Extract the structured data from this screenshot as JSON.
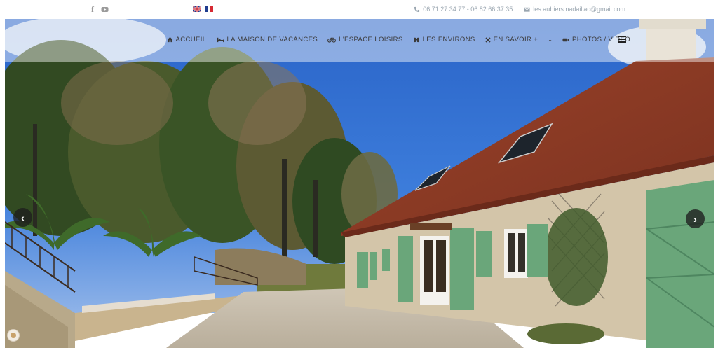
{
  "topbar": {
    "social": [
      {
        "icon": "facebook-icon",
        "glyph": "f"
      },
      {
        "icon": "youtube-icon"
      }
    ],
    "languages": [
      {
        "icon": "uk-flag-icon",
        "code": "en"
      },
      {
        "icon": "fr-flag-icon",
        "code": "fr"
      }
    ],
    "phone": "06 71 27 34 77 - 06 82 66 37 35",
    "email": "les.aubiers.nadaillac@gmail.com"
  },
  "nav": {
    "items": [
      {
        "label": "ACCUEIL",
        "icon": "home-icon"
      },
      {
        "label": "LA MAISON DE VACANCES",
        "icon": "bed-icon"
      },
      {
        "label": "L'ESPACE LOISIRS",
        "icon": "bicycle-icon"
      },
      {
        "label": "LES ENVIRONS",
        "icon": "binoculars-icon"
      },
      {
        "label": "EN SAVOIR +",
        "icon": "close-icon"
      },
      {
        "label": "PHOTOS / VIDÉO",
        "icon": "video-camera-icon"
      }
    ],
    "dropdown_glyph": "⌄"
  },
  "slider": {
    "prev_glyph": "‹",
    "next_glyph": "›"
  },
  "colors": {
    "sky": "#2f6fd0",
    "roof": "#8f3b26",
    "stone": "#d9ccb3",
    "shutter": "#6aa67a",
    "foliage": "#3d5a2a"
  }
}
